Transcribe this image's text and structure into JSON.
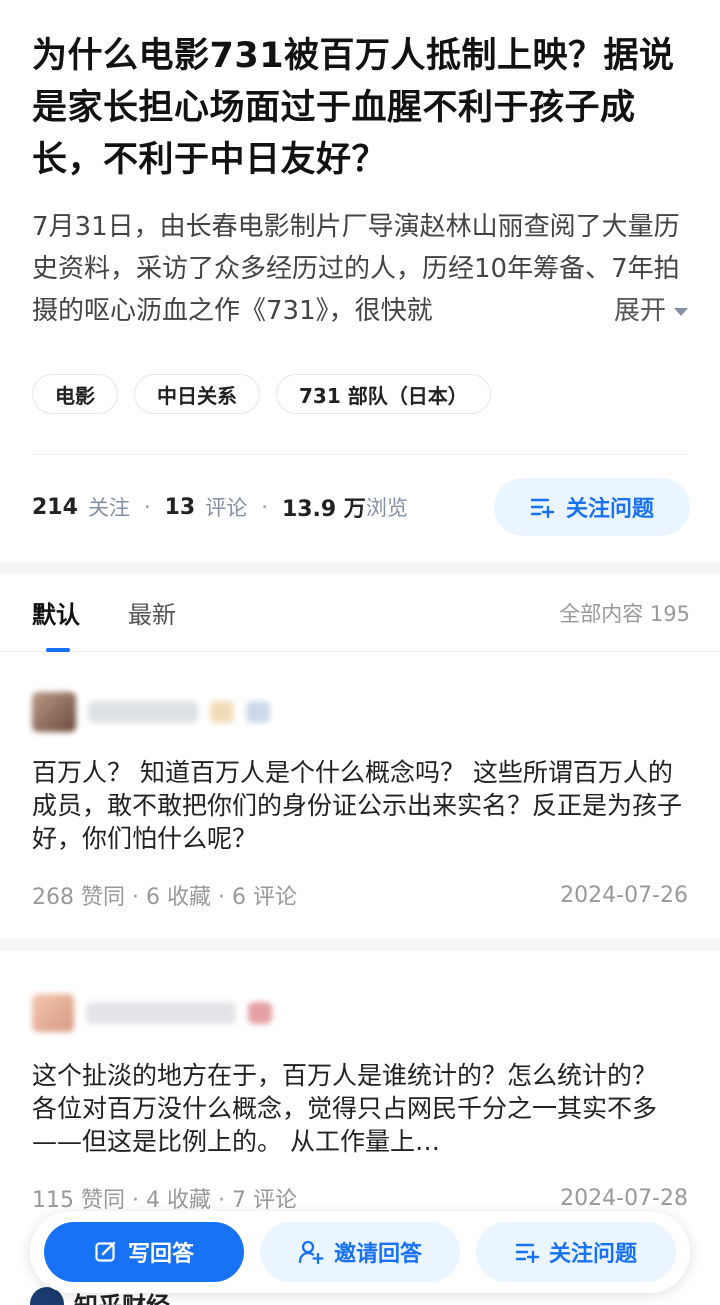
{
  "question": {
    "title": "为什么电影731被百万人抵制上映？据说是家长担心场面过于血腥不利于孩子成长，不利于中日友好？",
    "excerpt": "7月31日，由长春电影制片厂导演赵林山丽查阅了大量历史资料，采访了众多经历过的人，历经10年筹备、7年拍摄的呕心沥血之作《731》，很快就",
    "expand_label": "展开",
    "tags": [
      "电影",
      "中日关系",
      "731 部队（日本）"
    ]
  },
  "stats": {
    "followers_count": "214",
    "followers_label": "关注",
    "comments_count": "13",
    "comments_label": "评论",
    "views_count": "13.9 万",
    "views_label": "浏览",
    "follow_button": "关注问题"
  },
  "tabs": {
    "default": "默认",
    "latest": "最新",
    "total_label": "全部内容 195"
  },
  "answers": [
    {
      "text": "百万人？ 知道百万人是个什么概念吗？ 这些所谓百万人的成员，敢不敢把你们的身份证公示出来实名？反正是为孩子好，你们怕什么呢？",
      "likes": "268 赞同",
      "favorites": "6 收藏",
      "comments": "6 评论",
      "date": "2024-07-26"
    },
    {
      "text": "这个扯淡的地方在于，百万人是谁统计的？怎么统计的？ 各位对百万没什么概念，觉得只占网民千分之一其实不多——但这是比例上的。 从工作量上…",
      "likes": "115 赞同",
      "favorites": "4 收藏",
      "comments": "7 评论",
      "date": "2024-07-28"
    }
  ],
  "bottom_bar": {
    "write_answer": "写回答",
    "invite_answer": "邀请回答",
    "follow_question": "关注问题"
  },
  "peek_author": "知乎财经",
  "colors": {
    "accent": "#1772f6",
    "accent_light": "#ebf5ff",
    "muted": "#8590a6"
  }
}
